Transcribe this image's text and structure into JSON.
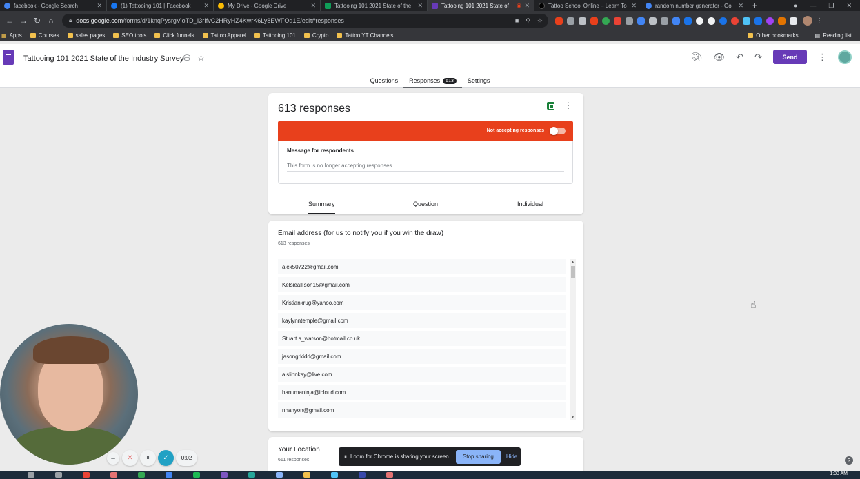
{
  "browser": {
    "tabs": [
      {
        "title": "facebook - Google Search",
        "color": "#4285f4",
        "active": false
      },
      {
        "title": "(1) Tattooing 101 | Facebook",
        "color": "#1877f2",
        "active": false
      },
      {
        "title": "My Drive - Google Drive",
        "color": "#fbbc04",
        "active": false
      },
      {
        "title": "Tattooing 101 2021 State of the",
        "color": "#0f9d58",
        "active": false
      },
      {
        "title": "Tattooing 101 2021 State of",
        "color": "#673ab7",
        "active": true
      },
      {
        "title": "Tattoo School Online – Learn To",
        "color": "#202124",
        "active": false
      },
      {
        "title": "random number generator - Go",
        "color": "#4285f4",
        "active": false
      }
    ],
    "url_host": "docs.google.com",
    "url_path": "/forms/d/1knqPysrgVioTD_I3rIfvC2HRyHZ4KwrK6Ly8EWFOq1E/edit#responses",
    "bookmarks": [
      "Apps",
      "Courses",
      "sales pages",
      "SEO tools",
      "Click funnels",
      "Tattoo Apparel",
      "Tattooing 101",
      "Crypto",
      "Tattoo YT Channels"
    ],
    "bookmarks_right": [
      "Other bookmarks",
      "Reading list"
    ]
  },
  "form": {
    "title": "Tattooing 101 2021 State of the Industry Survey",
    "send_label": "Send",
    "tabs": {
      "questions": "Questions",
      "responses": "Responses",
      "responses_count": "613",
      "settings": "Settings"
    }
  },
  "summary_card": {
    "title": "613 responses",
    "banner_text": "Not accepting responses",
    "message_label": "Message for respondents",
    "message_text": "This form is no longer accepting responses",
    "subtabs": {
      "summary": "Summary",
      "question": "Question",
      "individual": "Individual"
    }
  },
  "email_question": {
    "title": "Email address (for us to notify you if you win the draw)",
    "count": "613 responses",
    "emails": [
      "alex50722@gmail.com",
      "Kelsieallison15@gmail.com",
      "Kristiankrug@yahoo.com",
      "kaylynntemple@gmail.com",
      "Stuart.a_watson@hotmail.co.uk",
      "jasongrkidd@gmail.com",
      "aislinnkay@live.com",
      "hanumaninja@icloud.com",
      "nhanyon@gmail.com"
    ]
  },
  "location_question": {
    "title": "Your Location",
    "count": "611 responses"
  },
  "loom": {
    "sharing_text": "Loom for Chrome is sharing your screen.",
    "stop_label": "Stop sharing",
    "hide_label": "Hide",
    "timer": "0:02"
  },
  "taskbar": {
    "clock": "1:33 AM"
  },
  "colors": {
    "accent": "#673ab7",
    "banner": "#e8401c",
    "loom_blue": "#8ab4f8"
  }
}
